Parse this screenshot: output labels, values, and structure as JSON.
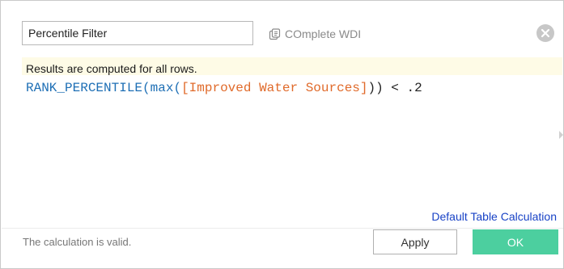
{
  "dialog": {
    "name_value": "Percentile Filter",
    "datasource_label": "COmplete WDI",
    "datasource_icon": "datasource-icon",
    "close_icon": "close-circle-icon"
  },
  "editor": {
    "info": "Results are computed for all rows.",
    "formula": {
      "fn_rank": "RANK_PERCENTILE",
      "paren_open": "(",
      "fn_max": "max",
      "paren_open2": "(",
      "field": "[Improved Water Sources]",
      "close_and_op": ")) < .2"
    }
  },
  "links": {
    "table_calc": "Default Table Calculation"
  },
  "footer": {
    "status": "The calculation is valid.",
    "apply_label": "Apply",
    "ok_label": "OK"
  },
  "colors": {
    "function": "#1e6fb5",
    "field": "#e06a2a",
    "info_bar": "#fefbe6",
    "ok_button": "#4ccf9f",
    "link": "#1842c6"
  }
}
